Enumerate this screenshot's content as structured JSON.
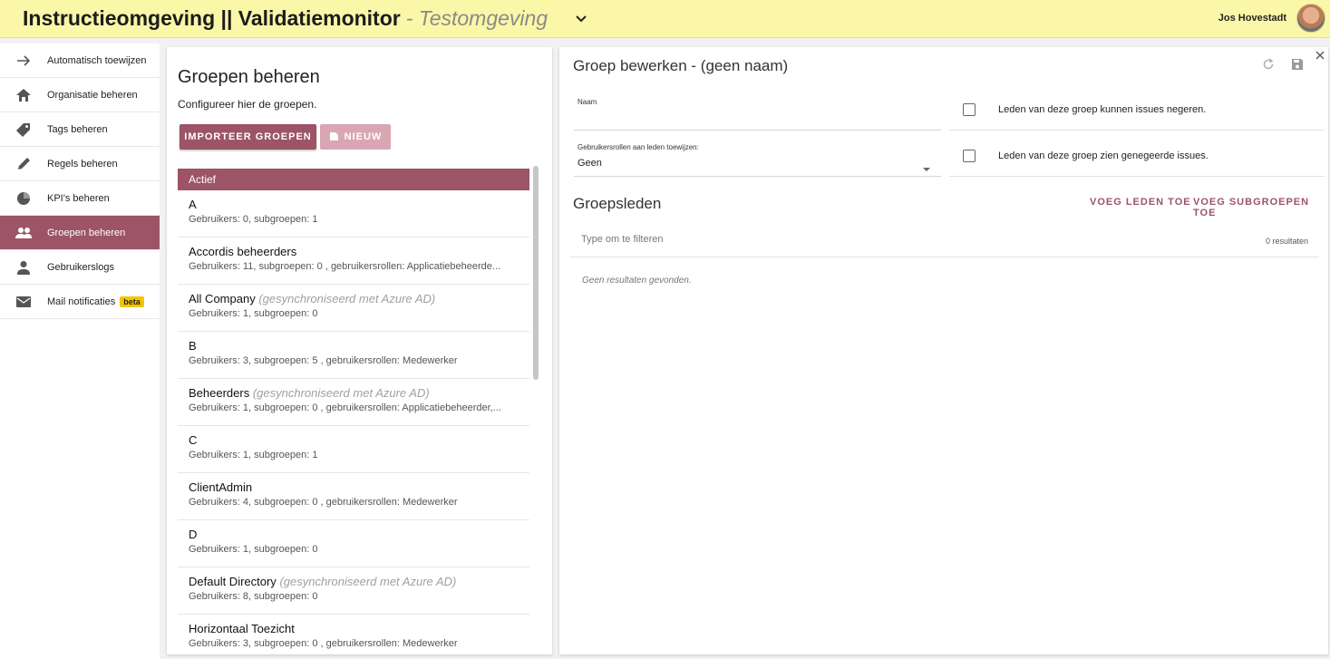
{
  "header": {
    "title": "Instructieomgeving || Validatiemonitor",
    "environment": "- Testomgeving",
    "user_name": "Jos Hovestadt"
  },
  "sidebar": {
    "items": [
      {
        "label": "Automatisch toewijzen",
        "icon": "arrow-right-icon"
      },
      {
        "label": "Organisatie beheren",
        "icon": "home-icon"
      },
      {
        "label": "Tags beheren",
        "icon": "tag-icon"
      },
      {
        "label": "Regels beheren",
        "icon": "pencil-icon"
      },
      {
        "label": "KPI's beheren",
        "icon": "pie-chart-icon"
      },
      {
        "label": "Groepen beheren",
        "icon": "group-icon",
        "active": true
      },
      {
        "label": "Gebruikerslogs",
        "icon": "person-icon"
      },
      {
        "label": "Mail notificaties",
        "icon": "mail-icon",
        "badge": "beta"
      }
    ]
  },
  "groups_panel": {
    "title": "Groepen beheren",
    "subtitle": "Configureer hier de groepen.",
    "import_label": "IMPORTEER GROEPEN",
    "new_label": "NIEUW",
    "list_header": "Actief",
    "groups": [
      {
        "name": "A",
        "sync": "",
        "detail": "Gebruikers: 0, subgroepen: 1"
      },
      {
        "name": "Accordis beheerders",
        "sync": "",
        "detail": "Gebruikers: 11, subgroepen: 0 , gebruikersrollen: Applicatiebeheerde..."
      },
      {
        "name": "All Company",
        "sync": "(gesynchroniseerd met Azure AD)",
        "detail": "Gebruikers: 1, subgroepen: 0"
      },
      {
        "name": "B",
        "sync": "",
        "detail": "Gebruikers: 3, subgroepen: 5 , gebruikersrollen: Medewerker"
      },
      {
        "name": "Beheerders",
        "sync": "(gesynchroniseerd met Azure AD)",
        "detail": "Gebruikers: 1, subgroepen: 0 , gebruikersrollen: Applicatiebeheerder,..."
      },
      {
        "name": "C",
        "sync": "",
        "detail": "Gebruikers: 1, subgroepen: 1"
      },
      {
        "name": "ClientAdmin",
        "sync": "",
        "detail": "Gebruikers: 4, subgroepen: 0 , gebruikersrollen: Medewerker"
      },
      {
        "name": "D",
        "sync": "",
        "detail": "Gebruikers: 1, subgroepen: 0"
      },
      {
        "name": "Default Directory",
        "sync": "(gesynchroniseerd met Azure AD)",
        "detail": "Gebruikers: 8, subgroepen: 0"
      },
      {
        "name": "Horizontaal Toezicht",
        "sync": "",
        "detail": "Gebruikers: 3, subgroepen: 0 , gebruikersrollen: Medewerker"
      }
    ]
  },
  "edit_panel": {
    "title": "Groep bewerken - (geen naam)",
    "name_label": "Naam",
    "name_value": "",
    "roles_label": "Gebruikersrollen aan leden toewijzen:",
    "roles_value": "Geen",
    "checkbox_ignore": "Leden van deze groep kunnen issues negeren.",
    "checkbox_see_ignored": "Leden van deze groep zien genegeerde issues.",
    "members_title": "Groepsleden",
    "add_members": "VOEG LEDEN TOE",
    "add_subgroups": "VOEG SUBGROEPEN TOE",
    "filter_placeholder": "Type om te filteren",
    "result_count": "0 resultaten",
    "no_results": "Geen resultaten gevonden."
  },
  "colors": {
    "accent": "#9c5466",
    "header_bg": "#fbf7a8",
    "badge": "#f5c400"
  }
}
